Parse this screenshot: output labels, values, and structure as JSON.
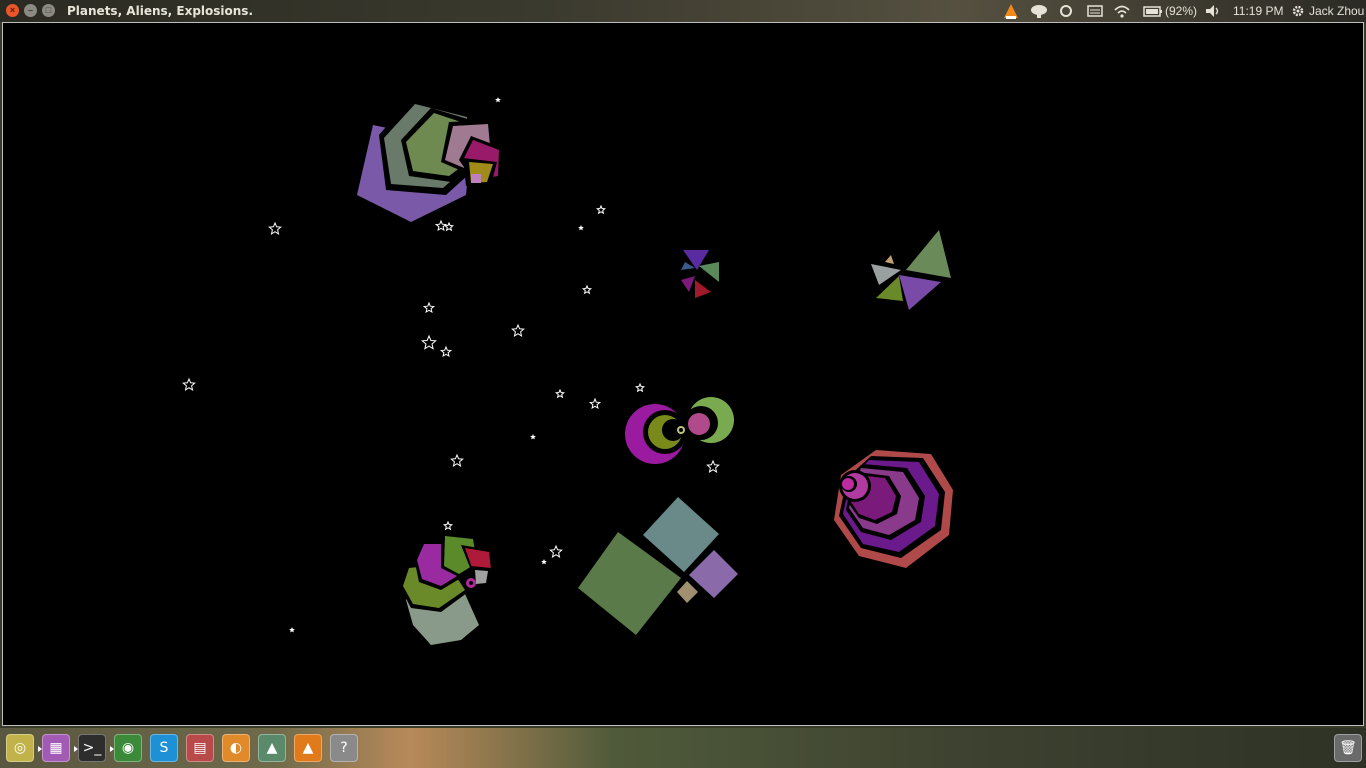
{
  "window": {
    "title": "Planets, Aliens, Explosions.",
    "close_glyph": "×",
    "minimize_glyph": "–",
    "maximize_glyph": "□"
  },
  "indicators": {
    "battery": "(92%)",
    "clock": "11:19 PM",
    "user": "Jack Zhou"
  },
  "dock": {
    "items": [
      {
        "name": "ubuntu-dash",
        "glyph": "◎",
        "color": "#c2b24a"
      },
      {
        "name": "video-player",
        "glyph": "▦",
        "color": "#a25bb5"
      },
      {
        "name": "terminal",
        "glyph": ">_",
        "color": "#2d2d2d"
      },
      {
        "name": "chrome",
        "glyph": "◉",
        "color": "#3a8a3a"
      },
      {
        "name": "skype",
        "glyph": "S",
        "color": "#1e90d6"
      },
      {
        "name": "file-roller",
        "glyph": "▤",
        "color": "#b84a4a"
      },
      {
        "name": "blender",
        "glyph": "◐",
        "color": "#e08a2a"
      },
      {
        "name": "image-viewer",
        "glyph": "▲",
        "color": "#5a8a6a"
      },
      {
        "name": "vlc",
        "glyph": "▲",
        "color": "#e07a1a"
      },
      {
        "name": "unknown-app",
        "glyph": "?",
        "color": "#8a8a8a"
      }
    ],
    "trash": {
      "glyph": "🗑",
      "color": "#6a6a6a"
    }
  },
  "colors": {
    "panel_text": "#dfdbd2",
    "game_background": "#000000",
    "star": "#ffffff"
  }
}
